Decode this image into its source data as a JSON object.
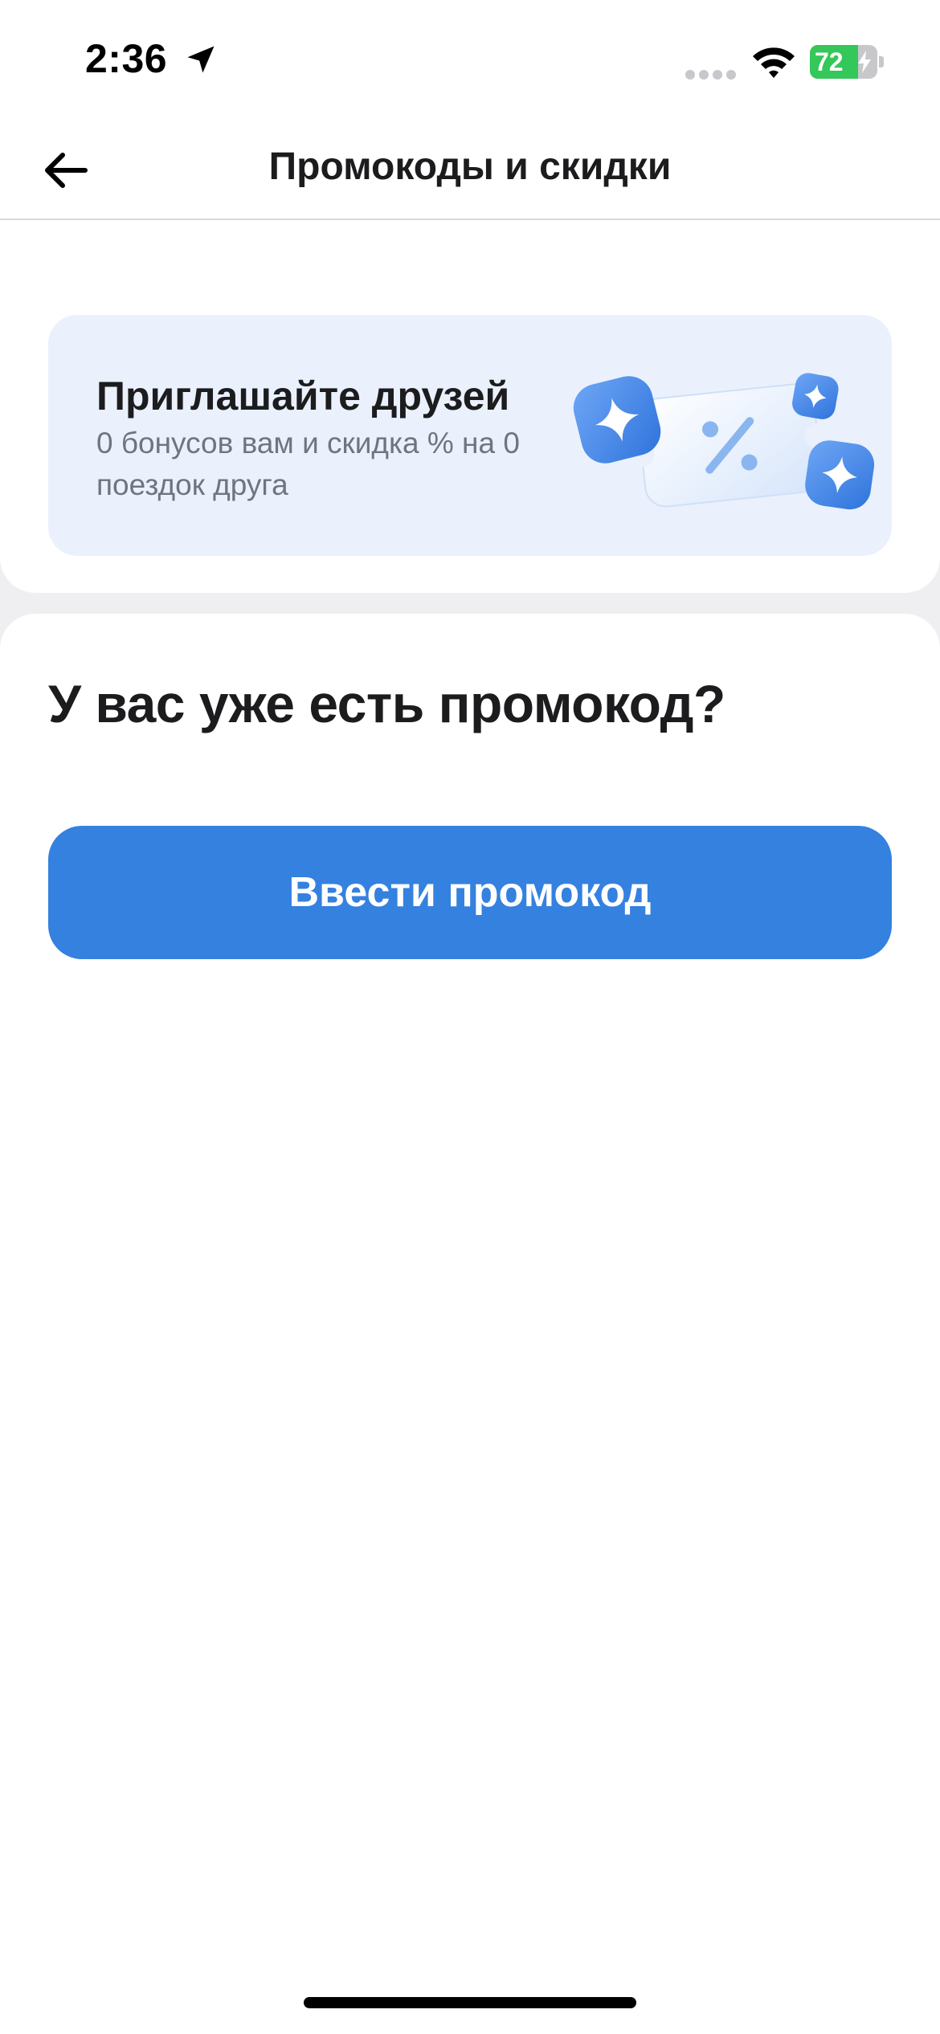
{
  "status_bar": {
    "time": "2:36",
    "battery_level": "72",
    "battery_fraction": 0.72,
    "icons": [
      "location-arrow-icon",
      "cellular-signal-icon",
      "wifi-icon",
      "battery-charging-icon"
    ]
  },
  "nav": {
    "title": "Промокоды и скидки",
    "back_icon": "arrow-left-icon"
  },
  "invite_banner": {
    "title": "Приглашайте друзей",
    "subtitle": "0 бонусов вам и скидка % на 0 поездок друга",
    "illustration": "coupon-percent-sparkles-illustration"
  },
  "promo_section": {
    "question": "У вас уже есть промокод?",
    "button_label": "Ввести промокод"
  },
  "colors": {
    "accent": "#3481e0",
    "banner_bg": "#eaf1fd",
    "page_bg": "#efeff1",
    "battery_green": "#34c759"
  }
}
